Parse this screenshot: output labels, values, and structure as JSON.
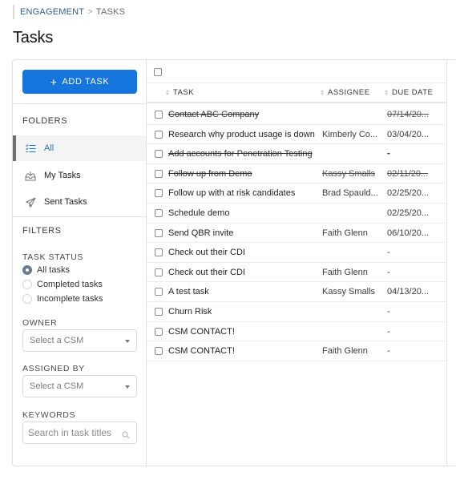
{
  "breadcrumb": {
    "parent": "ENGAGEMENT",
    "separator": ">",
    "current": "TASKS"
  },
  "page_title": "Tasks",
  "sidebar": {
    "add_task_label": "ADD TASK",
    "folders_label": "FOLDERS",
    "folders": [
      {
        "label": "All",
        "icon": "list-check-icon",
        "active": true
      },
      {
        "label": "My Tasks",
        "icon": "inbox-tray-icon",
        "active": false
      },
      {
        "label": "Sent Tasks",
        "icon": "paper-plane-icon",
        "active": false
      }
    ],
    "filters_label": "FILTERS",
    "task_status": {
      "label": "TASK STATUS",
      "options": [
        {
          "label": "All tasks",
          "checked": true
        },
        {
          "label": "Completed tasks",
          "checked": false
        },
        {
          "label": "Incomplete tasks",
          "checked": false
        }
      ]
    },
    "owner": {
      "label": "OWNER",
      "placeholder": "Select a CSM"
    },
    "assigned_by": {
      "label": "ASSIGNED BY",
      "placeholder": "Select a CSM"
    },
    "keywords": {
      "label": "KEYWORDS",
      "placeholder": "Search in task titles",
      "value": ""
    }
  },
  "table": {
    "columns": [
      "TASK",
      "ASSIGNEE",
      "DUE DATE"
    ],
    "rows": [
      {
        "task": "Contact ABC Company",
        "assignee": "",
        "due": "07/14/20...",
        "completed": true
      },
      {
        "task": "Research why product usage is down",
        "assignee": "Kimberly Co...",
        "due": "03/04/20...",
        "completed": false
      },
      {
        "task": "Add accounts for Penetration Testing",
        "assignee": "",
        "due": "-",
        "completed": true
      },
      {
        "task": "Follow up from Demo",
        "assignee": "Kassy Smalls",
        "due": "02/11/20...",
        "completed": true
      },
      {
        "task": "Follow up with at risk candidates",
        "assignee": "Brad Spauld...",
        "due": "02/25/20...",
        "completed": false
      },
      {
        "task": "Schedule demo",
        "assignee": "",
        "due": "02/25/20...",
        "completed": false
      },
      {
        "task": "Send QBR invite",
        "assignee": "Faith Glenn",
        "due": "06/10/20...",
        "completed": false
      },
      {
        "task": "Check out their CDI",
        "assignee": "",
        "due": "-",
        "completed": false
      },
      {
        "task": "Check out their CDI",
        "assignee": "Faith Glenn",
        "due": "-",
        "completed": false
      },
      {
        "task": "A test task",
        "assignee": "Kassy Smalls",
        "due": "04/13/20...",
        "completed": false
      },
      {
        "task": "Churn Risk",
        "assignee": "",
        "due": "-",
        "completed": false
      },
      {
        "task": "CSM CONTACT!",
        "assignee": "",
        "due": "-",
        "completed": false
      },
      {
        "task": "CSM CONTACT!",
        "assignee": "Faith Glenn",
        "due": "-",
        "completed": false
      }
    ]
  },
  "colors": {
    "primary": "#1674dd",
    "breadcrumb_link": "#2f5f91",
    "active_folder_bg": "#f4f4f4"
  }
}
